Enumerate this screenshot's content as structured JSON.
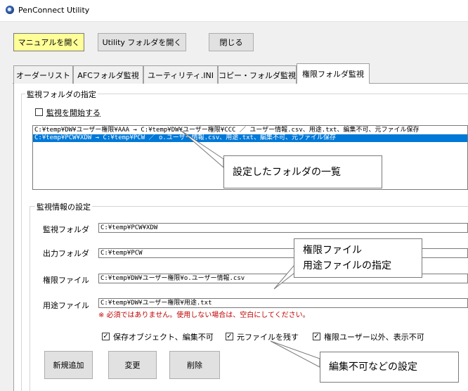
{
  "window": {
    "title": "PenConnect Utility"
  },
  "toolbar": {
    "open_manual": "マニュアルを開く",
    "open_utility_folder": "Utility フォルダを開く",
    "close": "閉じる"
  },
  "tabs": [
    {
      "label": "オーダーリスト",
      "active": false
    },
    {
      "label": "AFCフォルダ監視",
      "active": false
    },
    {
      "label": "ユーティリティ.INI",
      "active": false
    },
    {
      "label": "コピー・フォルダ監視",
      "active": false
    },
    {
      "label": "権限フォルダ監視",
      "active": true
    }
  ],
  "monitor_folders": {
    "group_label": "監視フォルダの指定",
    "start_checkbox_label": "監視を開始する",
    "start_checked": false,
    "items": [
      {
        "text": "C:¥temp¥DW¥ユーザー権限¥AAA → C:¥temp¥DW¥ユーザー権限¥CCC ／ ユーザー情報.csv、用途.txt、編集不可、元ファイル保存",
        "selected": false
      },
      {
        "text": "C:¥temp¥PCW¥XDW → C:¥temp¥PCW ／ o.ユーザー情報.csv、用途.txt、編集不可、元ファイル保存",
        "selected": true
      }
    ]
  },
  "monitor_info": {
    "group_label": "監視情報の設定",
    "monitor_folder_label": "監視フォルダ",
    "monitor_folder_value": "C:¥temp¥PCW¥XDW",
    "output_folder_label": "出力フォルダ",
    "output_folder_value": "C:¥temp¥PCW",
    "permission_file_label": "権限ファイル",
    "permission_file_value": "C:¥temp¥DW¥ユーザー権限¥o.ユーザー情報.csv",
    "usage_file_label": "用途ファイル",
    "usage_file_value": "C:¥temp¥DW¥ユーザー権限¥用途.txt",
    "note": "※ 必須ではありません。使用しない場合は、空白にしてください。",
    "opt_keep_object_label": "保存オブジェクト、編集不可",
    "opt_keep_object_checked": true,
    "opt_keep_original_label": "元ファイルを残す",
    "opt_keep_original_checked": true,
    "opt_hide_label": "権限ユーザー以外、表示不可",
    "opt_hide_checked": true,
    "btn_add": "新規追加",
    "btn_change": "変更",
    "btn_delete": "削除"
  },
  "callouts": {
    "folder_list": "設定したフォルダの一覧",
    "files_line1": "権限ファイル",
    "files_line2": "用途ファイルの指定",
    "settings": "編集不可などの設定"
  },
  "colors": {
    "accent": "#0078d7",
    "manual_button": "#ffff99",
    "note": "#c00000"
  }
}
